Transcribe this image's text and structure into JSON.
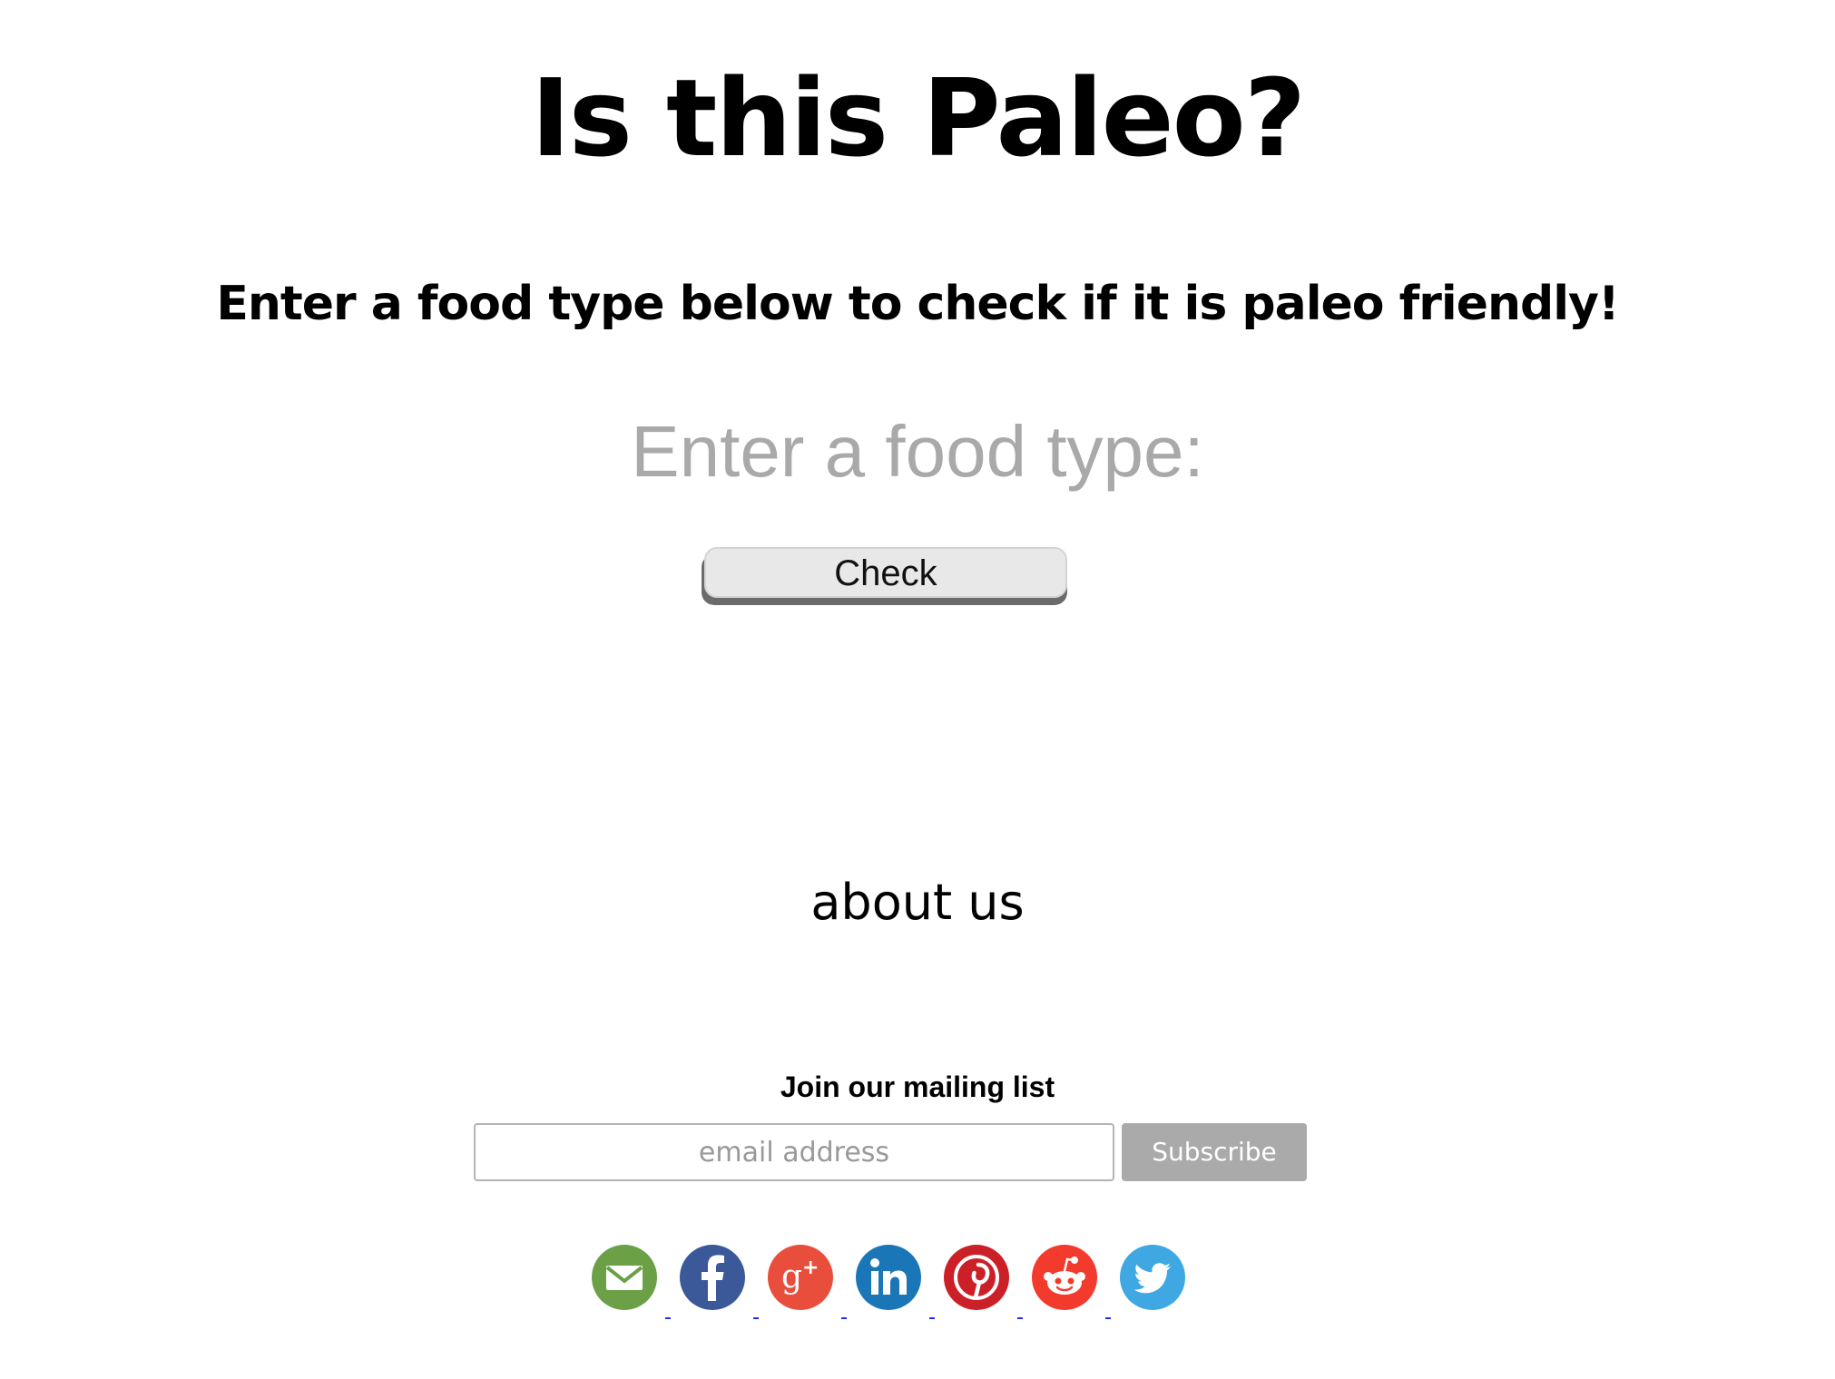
{
  "header": {
    "title": "Is this Paleo?",
    "subtitle": "Enter a food type below to check if it is paleo friendly!"
  },
  "checker": {
    "placeholder": "Enter a food type:",
    "value": "",
    "button_label": "Check"
  },
  "footer": {
    "about_label": "about us",
    "mailing_heading": "Join our mailing list",
    "email_placeholder": "email address",
    "subscribe_label": "Subscribe"
  },
  "social": [
    {
      "name": "email-icon",
      "color": "#6ba046"
    },
    {
      "name": "facebook-icon",
      "color": "#3b5998"
    },
    {
      "name": "google-plus-icon",
      "color": "#e94e3c"
    },
    {
      "name": "linkedin-icon",
      "color": "#1b76b7"
    },
    {
      "name": "pinterest-icon",
      "color": "#cb2027"
    },
    {
      "name": "reddit-icon",
      "color": "#f23b2c"
    },
    {
      "name": "twitter-icon",
      "color": "#3fa8e3"
    }
  ]
}
